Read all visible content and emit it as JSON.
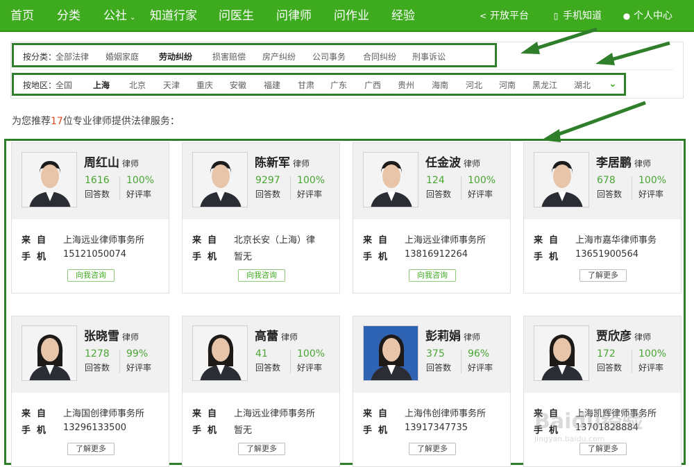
{
  "nav": {
    "items": [
      "首页",
      "分类",
      "公社",
      "知道行家",
      "问医生",
      "问律师",
      "问作业",
      "经验"
    ],
    "right": [
      {
        "icon": "share-icon",
        "label": "开放平台"
      },
      {
        "icon": "mobile-icon",
        "label": "手机知道"
      },
      {
        "icon": "user-icon",
        "label": "个人中心"
      }
    ]
  },
  "filters": {
    "category_label": "按分类：",
    "categories": [
      "全部法律",
      "婚姻家庭",
      "劳动纠纷",
      "损害赔偿",
      "房产纠纷",
      "公司事务",
      "合同纠纷",
      "刑事诉讼"
    ],
    "category_active": "劳动纠纷",
    "region_label": "按地区：",
    "regions": [
      "全国",
      "上海",
      "北京",
      "天津",
      "重庆",
      "安徽",
      "福建",
      "甘肃",
      "广东",
      "广西",
      "贵州",
      "海南",
      "河北",
      "河南",
      "黑龙江",
      "湖北"
    ],
    "region_active": "上海"
  },
  "recommend": {
    "prefix": "为您推荐",
    "count": "17",
    "suffix": "位专业律师提供法律服务："
  },
  "card_labels": {
    "title": "律师",
    "answers_label": "回答数",
    "rate_label": "好评率",
    "from_label": "来自",
    "phone_label": "手机",
    "consult_button": "向我咨询",
    "more_button": "了解更多"
  },
  "lawyers": [
    {
      "name": "周红山",
      "answers": "1616",
      "rate": "100%",
      "from": "上海远业律师事务所",
      "phone": "15121050074",
      "button": "consult"
    },
    {
      "name": "陈新军",
      "answers": "9297",
      "rate": "100%",
      "from": "北京长安（上海）律",
      "phone": "暂无",
      "button": "consult"
    },
    {
      "name": "任金波",
      "answers": "124",
      "rate": "100%",
      "from": "上海远业律师事务所",
      "phone": "13816912264",
      "button": "consult"
    },
    {
      "name": "李居鹏",
      "answers": "678",
      "rate": "100%",
      "from": "上海市嘉华律师事务",
      "phone": "13651900564",
      "button": "more"
    },
    {
      "name": "张晓雪",
      "answers": "1278",
      "rate": "99%",
      "from": "上海国创律师事务所",
      "phone": "13296133500",
      "button": "more"
    },
    {
      "name": "高蕾",
      "answers": "41",
      "rate": "100%",
      "from": "上海远业律师事务所",
      "phone": "暂无",
      "button": "more"
    },
    {
      "name": "彭莉娟",
      "answers": "375",
      "rate": "96%",
      "from": "上海伟创律师事务所",
      "phone": "13917347735",
      "button": "more"
    },
    {
      "name": "贾欣彦",
      "answers": "172",
      "rate": "100%",
      "from": "上海凯辉律师事务所",
      "phone": "13701828884",
      "button": "more"
    }
  ],
  "watermark": {
    "brand": "Baidu经验",
    "url": "jingyan.baidu.com"
  },
  "colors": {
    "brand_green": "#3eab1f",
    "highlight_green": "#2f7e2a",
    "count_orange": "#e0461d"
  }
}
